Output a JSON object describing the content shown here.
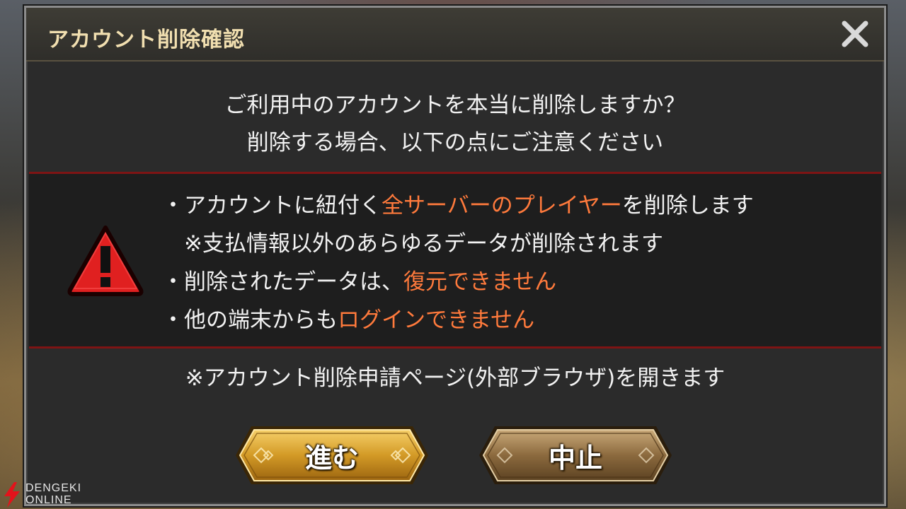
{
  "dialog": {
    "title": "アカウント削除確認",
    "close_icon": "close-icon",
    "intro_line1": "ご利用中のアカウントを本当に削除しますか？",
    "intro_line2": "削除する場合、以下の点にご注意ください",
    "warning_icon": "warning-triangle-icon",
    "bullets": [
      {
        "prefix": "・アカウントに紐付く",
        "highlight": "全サーバーのプレイヤー",
        "suffix": "を削除します"
      },
      {
        "prefix": "　※支払情報以外のあらゆるデータが削除されます",
        "highlight": "",
        "suffix": ""
      },
      {
        "prefix": "・削除されたデータは、",
        "highlight": "復元できません",
        "suffix": ""
      },
      {
        "prefix": "・他の端末からも",
        "highlight": "ログインできません",
        "suffix": ""
      }
    ],
    "note": "※アカウント削除申請ページ(外部ブラウザ)を開きます",
    "proceed_label": "進む",
    "cancel_label": "中止"
  },
  "watermark": {
    "line1": "DENGEKI",
    "line2": "ONLINE"
  },
  "colors": {
    "highlight": "#ff7a3c",
    "title": "#f1dfb0",
    "warning_red": "#e02020",
    "proceed_gold": "#c98d1c",
    "cancel_bronze": "#8a6a3e"
  }
}
